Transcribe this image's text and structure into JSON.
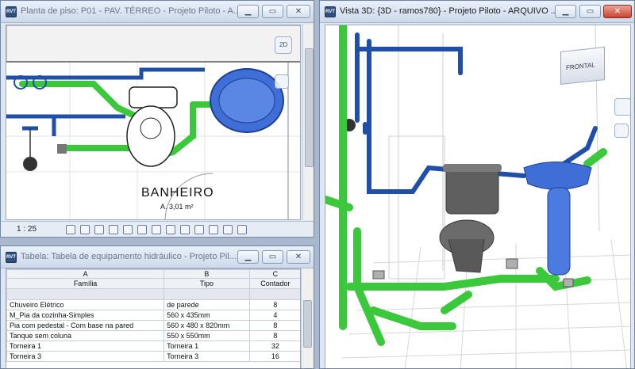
{
  "floor_plan_window": {
    "title": "Planta de piso: P01 - PAV. TÉRREO - Projeto Piloto - A...",
    "room_name": "BANHEIRO",
    "room_area": "A. 3,01 m²",
    "scale": "1 : 25",
    "view_cube_label": "2D"
  },
  "view3d_window": {
    "title": "Vista 3D: {3D - ramos780} - Projeto Piloto - ARQUIVO ...",
    "view_cube_label": "FRONTAL"
  },
  "schedule_window": {
    "title": "Tabela: Tabela de equipamento hidráulico - Projeto Pil...",
    "column_letters": [
      "A",
      "B",
      "C"
    ],
    "columns": [
      "Família",
      "Tipo",
      "Contador"
    ],
    "rows": [
      {
        "familia": "Chuveiro Elétrico",
        "tipo": "de parede",
        "contador": "8"
      },
      {
        "familia": "M_Pia da cozinha-Simples",
        "tipo": "560 x 435mm",
        "contador": "4"
      },
      {
        "familia": "Pia com pedestal - Com base na pared",
        "tipo": "560 x 480 x 820mm",
        "contador": "8"
      },
      {
        "familia": "Tanque sem coluna",
        "tipo": "550 x 550mm",
        "contador": "8"
      },
      {
        "familia": "Torneira 1",
        "tipo": "Torneira 1",
        "contador": "32"
      },
      {
        "familia": "Torneira 3",
        "tipo": "Torneira 3",
        "contador": "16"
      }
    ]
  },
  "window_controls": {
    "minimize": "▁",
    "maximize": "▭",
    "close": "✕"
  },
  "colors": {
    "pipe_green": "#3cc83c",
    "pipe_blue": "#1f4fa8",
    "fixture_blue": "#3f6fd6",
    "toilet_gray": "#6b6b6b"
  }
}
